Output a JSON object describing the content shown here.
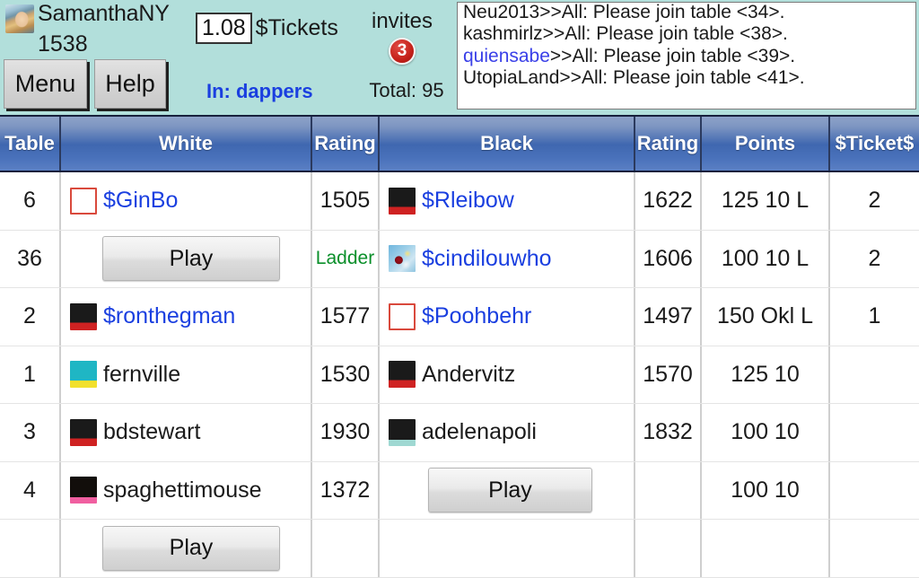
{
  "user": {
    "name": "SamanthaNY",
    "rating": "1538",
    "avatar_icon": "user-photo-avatar"
  },
  "toolbar": {
    "menu_label": "Menu",
    "help_label": "Help"
  },
  "tickets": {
    "value": "1.08",
    "label": "$Tickets"
  },
  "room": {
    "in_label": "In: dappers"
  },
  "invites": {
    "label": "invites",
    "count": "3",
    "total_label": "Total: 95",
    "badge_color": "#c5211a"
  },
  "chat": {
    "lines": [
      {
        "sender": "Neu2013",
        "text": "Neu2013>>All: Please join table <34>.",
        "highlight": false
      },
      {
        "sender": "kashmirlz",
        "text": "kashmirlz>>All: Please join table <38>.",
        "highlight": false
      },
      {
        "sender": "quiensabe",
        "prefix": "quiensabe",
        "rest": ">>All: Please join table <39>.",
        "highlight": true
      },
      {
        "sender": "UtopiaLand",
        "text": "UtopiaLand>>All: Please join table <41>.",
        "highlight": false
      }
    ]
  },
  "table": {
    "headers": {
      "table": "Table",
      "white": "White",
      "white_rating": "Rating",
      "black": "Black",
      "black_rating": "Rating",
      "points": "Points",
      "tickets": "$Ticket$"
    },
    "header_bg": "#3f67b0",
    "rows": [
      {
        "table": "6",
        "white": {
          "name": "$GinBo",
          "avatar": "empty-red-box",
          "dollar": true,
          "type": "player"
        },
        "white_rating": "1505",
        "black": {
          "name": "$Rleibow",
          "avatar": "face-sunglasses-red",
          "dollar": true,
          "type": "player"
        },
        "black_rating": "1622",
        "points": "125 10 L",
        "tickets": "2"
      },
      {
        "table": "36",
        "white": {
          "type": "button",
          "label": "Play"
        },
        "white_rating": "Ladder",
        "white_rating_style": "ladder",
        "black": {
          "name": "$cindilouwho",
          "avatar": "picture-abstract",
          "dollar": true,
          "type": "player"
        },
        "black_rating": "1606",
        "points": "100 10 L",
        "tickets": "2"
      },
      {
        "table": "2",
        "white": {
          "name": "$ronthegman",
          "avatar": "face-sunglasses-red",
          "dollar": true,
          "type": "player"
        },
        "white_rating": "1577",
        "black": {
          "name": "$Poohbehr",
          "avatar": "empty-red-box",
          "dollar": true,
          "type": "player"
        },
        "black_rating": "1497",
        "points": "150 Okl L",
        "tickets": "1"
      },
      {
        "table": "1",
        "white": {
          "name": "fernville",
          "avatar": "face-bluehair-yellow",
          "dollar": false,
          "type": "player"
        },
        "white_rating": "1530",
        "black": {
          "name": "Andervitz",
          "avatar": "face-sunglasses-red",
          "dollar": false,
          "type": "player"
        },
        "black_rating": "1570",
        "points": "125 10",
        "tickets": ""
      },
      {
        "table": "3",
        "white": {
          "name": "bdstewart",
          "avatar": "face-sunglasses-red",
          "dollar": false,
          "type": "player"
        },
        "white_rating": "1930",
        "black": {
          "name": "adelenapoli",
          "avatar": "face-darkhair-teal",
          "dollar": false,
          "type": "player"
        },
        "black_rating": "1832",
        "points": "100 10",
        "tickets": ""
      },
      {
        "table": "4",
        "white": {
          "name": "spaghettimouse",
          "avatar": "face-darkhair-pink",
          "dollar": false,
          "type": "player"
        },
        "white_rating": "1372",
        "black": {
          "type": "button",
          "label": "Play"
        },
        "black_rating": "",
        "points": "100 10",
        "tickets": ""
      },
      {
        "table": "",
        "white": {
          "type": "button",
          "label": "Play"
        },
        "white_rating": "",
        "black": {
          "type": "empty"
        },
        "black_rating": "",
        "points": "",
        "tickets": ""
      }
    ]
  }
}
